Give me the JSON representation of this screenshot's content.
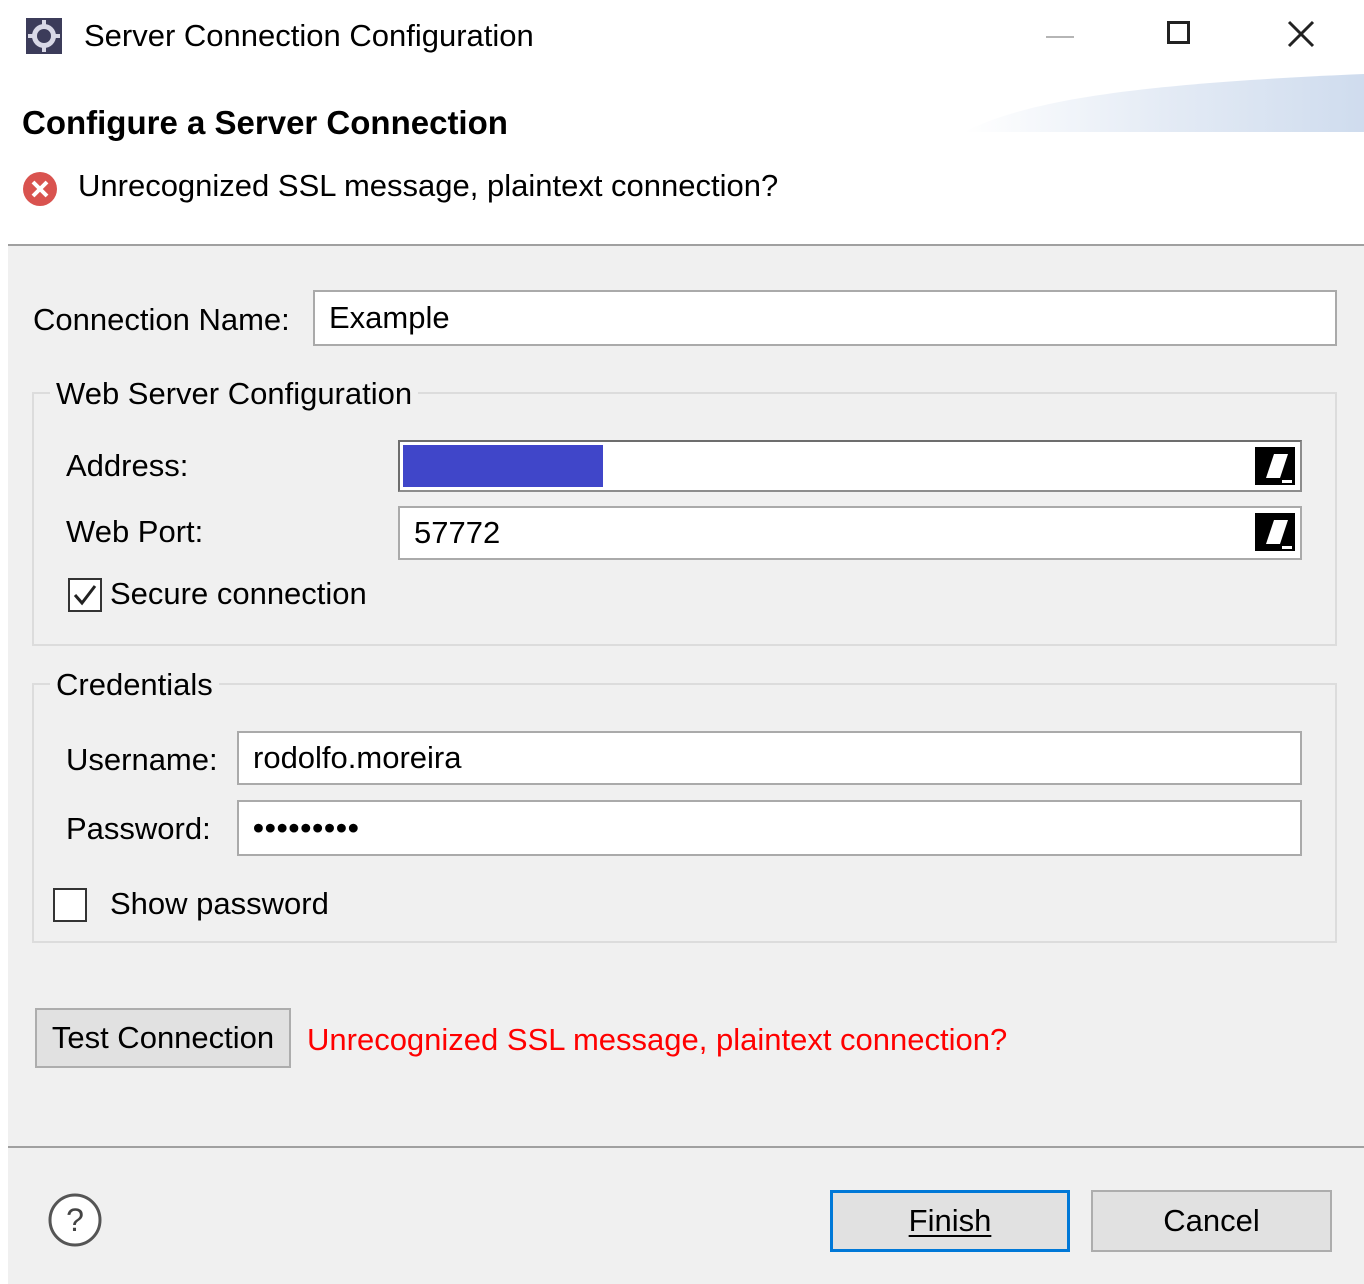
{
  "window": {
    "title": "Server Connection Configuration",
    "icon": "app-gear-icon",
    "controls": {
      "minimize": "minimize-icon",
      "maximize": "maximize-icon",
      "close": "close-icon"
    }
  },
  "header": {
    "title": "Configure a Server Connection",
    "message": "Unrecognized SSL message, plaintext connection?",
    "message_icon": "error-icon"
  },
  "form": {
    "connection_name_label": "Connection Name:",
    "connection_name_value": "Example",
    "web_server_group": {
      "title": "Web Server Configuration",
      "address_label": "Address:",
      "address_value": "",
      "web_port_label": "Web Port:",
      "web_port_value": "57772",
      "secure_label": "Secure connection",
      "secure_checked": true
    },
    "credentials_group": {
      "title": "Credentials",
      "username_label": "Username:",
      "username_value": "rodolfo.moreira",
      "password_label": "Password:",
      "password_value": "•••••••••",
      "show_password_label": "Show password",
      "show_password_checked": false
    },
    "test_connection_label": "Test Connection",
    "test_result_message": "Unrecognized SSL message, plaintext connection?"
  },
  "footer": {
    "help_icon": "help-icon",
    "finish_label": "Finish",
    "cancel_label": "Cancel"
  },
  "colors": {
    "content_bg": "#f0f0f0",
    "error_text": "#ff0000",
    "address_redaction": "#4046c9",
    "default_button_border": "#0078d7"
  }
}
